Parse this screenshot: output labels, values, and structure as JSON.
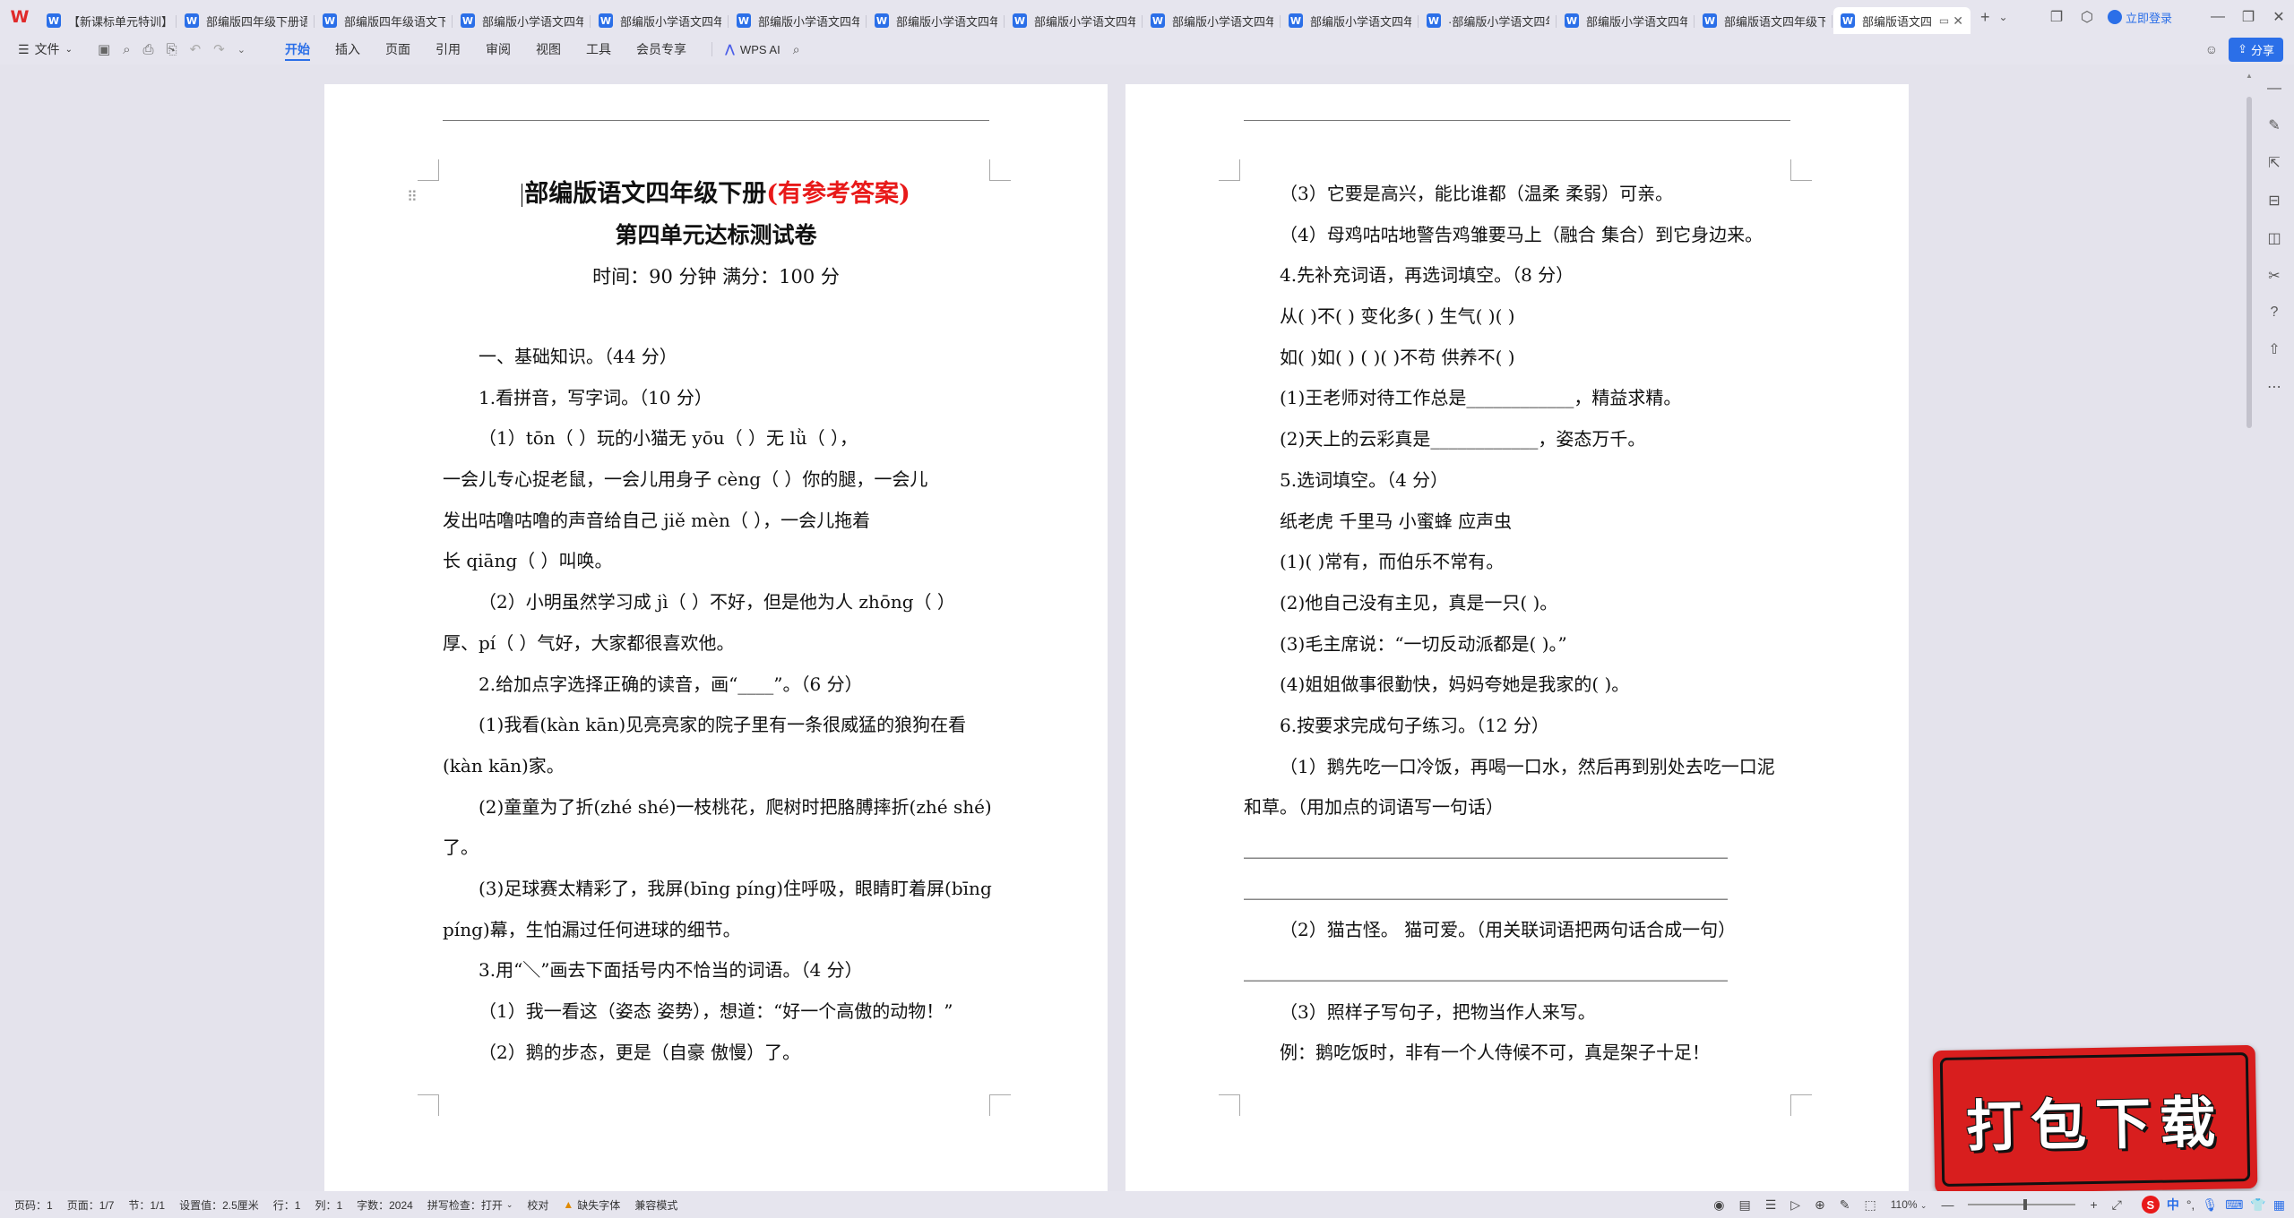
{
  "tabbar": {
    "tabs": [
      {
        "label": "【新课标单元特训】",
        "active": false
      },
      {
        "label": "部编版四年级下册语",
        "active": false
      },
      {
        "label": "部编版四年级语文下",
        "active": false
      },
      {
        "label": "部编版小学语文四年",
        "active": false
      },
      {
        "label": "部编版小学语文四年",
        "active": false
      },
      {
        "label": "部编版小学语文四年",
        "active": false
      },
      {
        "label": "部编版小学语文四年",
        "active": false
      },
      {
        "label": "部编版小学语文四年",
        "active": false
      },
      {
        "label": "部编版小学语文四年",
        "active": false
      },
      {
        "label": "部编版小学语文四年",
        "active": false
      },
      {
        "label": "·部编版小学语文四年",
        "active": false
      },
      {
        "label": "部编版小学语文四年",
        "active": false
      },
      {
        "label": "部编版语文四年级下",
        "active": false
      },
      {
        "label": "部编版语文四",
        "active": true
      }
    ],
    "login_label": "立即登录"
  },
  "menubar": {
    "file_label": "文件",
    "items": [
      "开始",
      "插入",
      "页面",
      "引用",
      "审阅",
      "视图",
      "工具",
      "会员专享"
    ],
    "active_index": 0,
    "wps_ai_label": "WPS AI",
    "share_label": "分享"
  },
  "document": {
    "title_main": "部编版语文四年级下册",
    "title_highlight": "(有参考答案)",
    "title_sub": "第四单元达标测试卷",
    "meta": "时间：90 分钟    满分：100 分",
    "page1_lines": [
      "一、基础知识。（44 分）",
      "1.看拼音，写字词。（10 分）",
      "（1）tōn（        ）玩的小猫无 yōu（        ）无 lǜ（        ），",
      "一会儿专心捉老鼠，一会儿用身子 cèng（        ）你的腿，一会儿",
      "发出咕噜咕噜的声音给自己 jiě mèn（              ），一会儿拖着",
      "长 qiāng（        ）叫唤。",
      "（2）小明虽然学习成 jì（      ）不好，但是他为人 zhōng（      ）",
      "厚、pí（        ）气好，大家都很喜欢他。",
      "2.给加点字选择正确的读音，画“____”。（6 分）",
      "(1)我看(kàn kān)见亮亮家的院子里有一条很威猛的狼狗在看",
      "(kàn kān)家。",
      "(2)童童为了折(zhé shé)一枝桃花，爬树时把胳膊摔折(zhé shé)",
      "了。",
      "(3)足球赛太精彩了，我屏(bīng píng)住呼吸，眼睛盯着屏(bīng",
      "píng)幕，生怕漏过任何进球的细节。",
      "3.用“＼”画去下面括号内不恰当的词语。（4 分）",
      "（1）我一看这（姿态   姿势），想道：“好一个高傲的动物！”",
      "（2）鹅的步态，更是（自豪   傲慢）了。"
    ],
    "page2_lines": [
      "（3）它要是高兴，能比谁都（温柔   柔弱）可亲。",
      "（4）母鸡咕咕地警告鸡雏要马上（融合   集合）到它身边来。",
      "4.先补充词语，再选词填空。（8 分）",
      "从(    )不(    )      变化多(    )          生气(    )(    )",
      "如(    )如(    )      (    )(    )不苟      供养不(    )",
      "(1)王老师对待工作总是____________，精益求精。",
      "(2)天上的云彩真是____________，姿态万千。",
      "5.选词填空。（4 分）",
      "纸老虎    千里马    小蜜蜂    应声虫",
      "(1)(        )常有，而伯乐不常有。",
      "(2)他自己没有主见，真是一只(        )。",
      "(3)毛主席说：“一切反动派都是(        )。”",
      "(4)姐姐做事很勤快，妈妈夸她是我家的(        )。",
      "6.按要求完成句子练习。（12 分）",
      "（1）鹅先吃一口冷饭，再喝一口水，然后再到别处去吃一口泥",
      "和草。（用加点的词语写一句话）",
      "______________________________________________________",
      "______________________________________________________",
      "（2）猫古怪。   猫可爱。（用关联词语把两句话合成一句）",
      "______________________________________________________",
      "（3）照样子写句子，把物当作人来写。",
      "例：鹅吃饭时，非有一个人侍候不可，真是架子十足！"
    ]
  },
  "badge": {
    "label": "打包下载"
  },
  "statusbar": {
    "page_num": "页码：1",
    "page_of": "页面：1/7",
    "section": "节：1/1",
    "setting": "设置值：2.5厘米",
    "row": "行：1",
    "col": "列：1",
    "word_count": "字数：2024",
    "spell_check": "拼写检查：打开",
    "proofread": "校对",
    "missing_fonts": "缺失字体",
    "compat_mode": "兼容模式",
    "zoom": "110%"
  }
}
